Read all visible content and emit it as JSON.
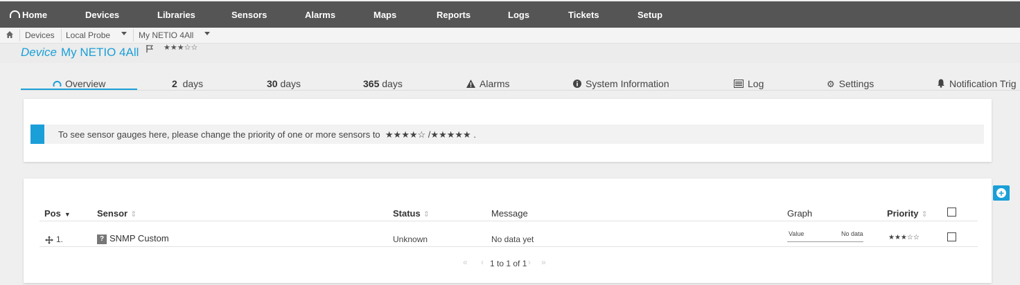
{
  "nav": {
    "home": "Home",
    "devices": "Devices",
    "libraries": "Libraries",
    "sensors": "Sensors",
    "alarms": "Alarms",
    "maps": "Maps",
    "reports": "Reports",
    "logs": "Logs",
    "tickets": "Tickets",
    "setup": "Setup"
  },
  "breadcrumb": {
    "devices": "Devices",
    "probe": "Local Probe",
    "device": "My NETIO 4All"
  },
  "header": {
    "prefix": "Device",
    "name": "My NETIO 4All",
    "stars": "★★★☆☆"
  },
  "tabs": {
    "overview": "Overview",
    "days2_num": "2",
    "days2_unit": "days",
    "days30_num": "30",
    "days30_unit": "days",
    "days365_num": "365",
    "days365_unit": "days",
    "alarms": "Alarms",
    "sysinfo": "System Information",
    "log": "Log",
    "settings": "Settings",
    "notif": "Notification Trig"
  },
  "notice": {
    "text": "To see sensor gauges here, please change the priority of one or more sensors to",
    "stars4": "★★★★☆",
    "sep": " /",
    "stars5": "★★★★★",
    "end": " ."
  },
  "table": {
    "headers": {
      "pos": "Pos",
      "sensor": "Sensor",
      "status": "Status",
      "message": "Message",
      "graph": "Graph",
      "priority": "Priority"
    },
    "rows": [
      {
        "pos": "1.",
        "sensor": "SNMP Custom",
        "status": "Unknown",
        "message": "No data yet",
        "graph_label": "Value",
        "graph_value": "No data",
        "priority": "★★★☆☆"
      }
    ],
    "pager": "1 to 1 of 1"
  },
  "colors": {
    "accent": "#1a9fd8",
    "nav_bg": "#555555"
  }
}
